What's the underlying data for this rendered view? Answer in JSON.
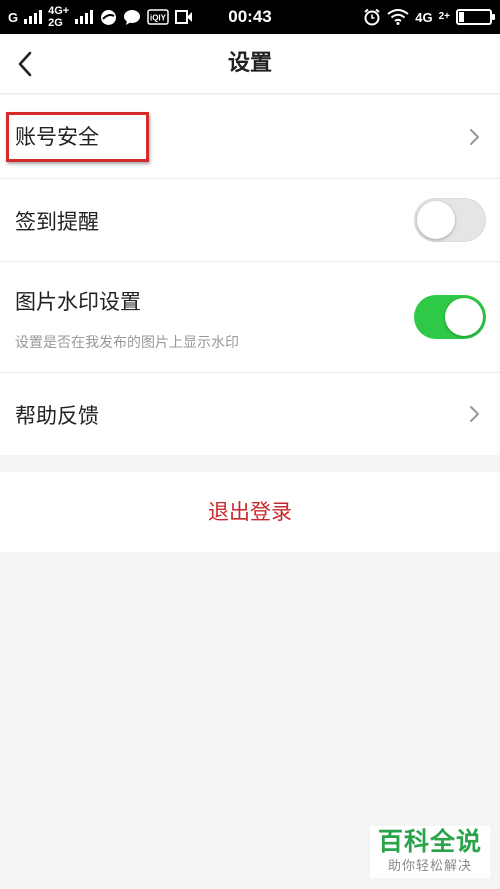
{
  "status_bar": {
    "carrier_left": "G",
    "network_top": "4G+",
    "network_bottom": "2G",
    "app_label": "iQIY",
    "time": "00:43",
    "network_right": "4G",
    "network_right_sub": "2+",
    "battery_level": 0.15
  },
  "header": {
    "title": "设置"
  },
  "rows": {
    "account_security": {
      "label": "账号安全"
    },
    "checkin_reminder": {
      "label": "签到提醒",
      "toggle_on": false
    },
    "image_watermark": {
      "label": "图片水印设置",
      "description": "设置是否在我发布的图片上显示水印",
      "toggle_on": true
    },
    "help_feedback": {
      "label": "帮助反馈"
    }
  },
  "logout": {
    "label": "退出登录"
  },
  "watermark": {
    "title": "百科全说",
    "subtitle": "助你轻松解决"
  },
  "colors": {
    "toggle_on": "#2ec946",
    "toggle_off": "#e5e5e5",
    "logout_text": "#c8282c",
    "highlight_box": "#d42c2c",
    "watermark_green": "#2ba34a"
  }
}
